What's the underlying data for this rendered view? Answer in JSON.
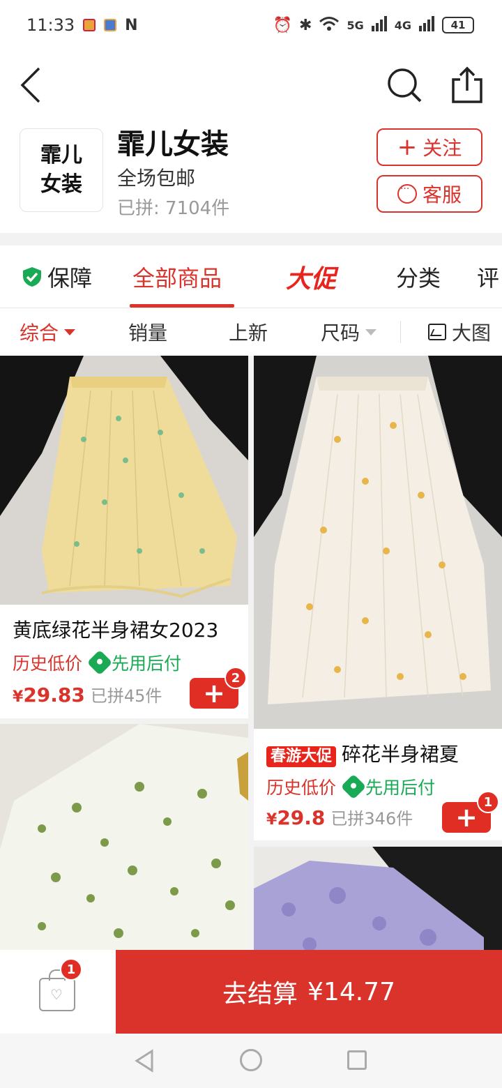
{
  "status_bar": {
    "time": "11:33",
    "network_1": "5G",
    "network_2": "4G",
    "battery": "41"
  },
  "nav": {
    "back_icon": "chevron-left-icon",
    "search_icon": "search-icon",
    "share_icon": "share-icon"
  },
  "shop": {
    "logo_text": "霏儿女装",
    "name": "霏儿女装",
    "subtitle": "全场包邮",
    "sold": "已拼: 7104件",
    "follow_label": "关注",
    "service_label": "客服"
  },
  "tabs": {
    "guarantee": "保障",
    "all_products": "全部商品",
    "promo": "大促",
    "category": "分类",
    "review": "评"
  },
  "sort": {
    "comprehensive": "综合",
    "sales": "销量",
    "new": "上新",
    "size": "尺码",
    "big_image": "大图"
  },
  "products": [
    {
      "title": "黄底绿花半身裙女2023",
      "tag_low": "历史低价",
      "tag_pay": "先用后付",
      "price": "29.83",
      "sold": "已拼45件",
      "cart_count": "2"
    },
    {
      "promo_tag": "春游大促",
      "title": "碎花半身裙夏",
      "tag_low": "历史低价",
      "tag_pay": "先用后付",
      "price": "29.8",
      "sold": "已拼346件",
      "cart_count": "1"
    }
  ],
  "currency_symbol": "¥",
  "bottom": {
    "cart_count": "1",
    "checkout_label": "去结算",
    "checkout_amount": "¥14.77"
  },
  "colors": {
    "accent": "#d9332b",
    "pay_green": "#1aaa55"
  }
}
